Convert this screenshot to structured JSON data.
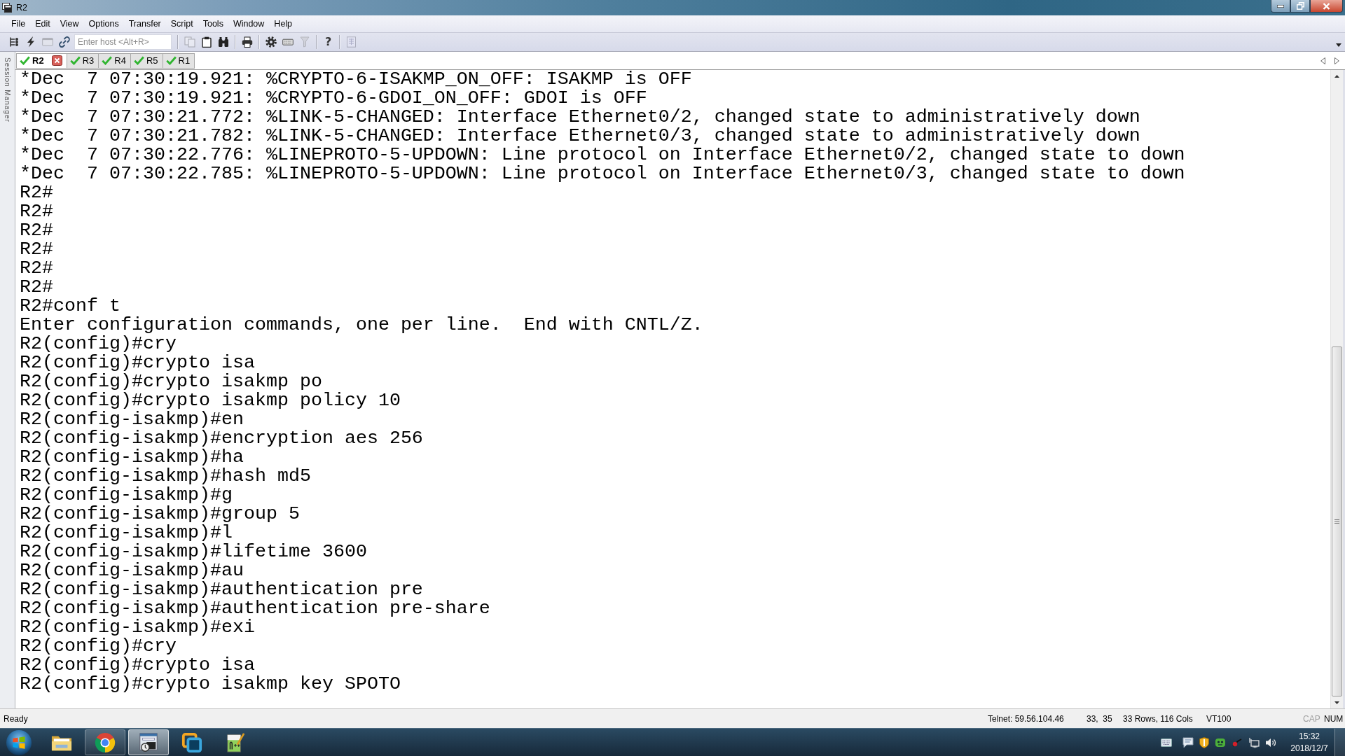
{
  "window": {
    "title": "R2"
  },
  "menu": [
    "File",
    "Edit",
    "View",
    "Options",
    "Transfer",
    "Script",
    "Tools",
    "Window",
    "Help"
  ],
  "toolbar": {
    "groups": [
      [
        {
          "kind": "connect",
          "disabled": false
        },
        {
          "kind": "quick_connect",
          "disabled": false
        },
        {
          "kind": "connect_in_tab",
          "disabled": true
        },
        {
          "kind": "reconnect",
          "disabled": false
        },
        {
          "kind": "host_field",
          "placeholder": "Enter host <Alt+R>",
          "disabled": false
        }
      ],
      [
        {
          "kind": "copy",
          "disabled": true
        },
        {
          "kind": "paste",
          "disabled": false
        },
        {
          "kind": "find",
          "disabled": false
        }
      ],
      [
        {
          "kind": "print",
          "disabled": false
        }
      ],
      [
        {
          "kind": "settings",
          "disabled": false
        },
        {
          "kind": "keymap",
          "disabled": false
        },
        {
          "kind": "filter",
          "disabled": true
        }
      ],
      [
        {
          "kind": "help",
          "label": "?",
          "disabled": false
        }
      ],
      [
        {
          "kind": "document",
          "disabled": true
        }
      ]
    ]
  },
  "side_panel": {
    "label": "Session Manager"
  },
  "tabs": [
    {
      "label": "R2",
      "selected": true,
      "connected": true
    },
    {
      "label": "R3",
      "selected": false,
      "connected": true
    },
    {
      "label": "R4",
      "selected": false,
      "connected": true
    },
    {
      "label": "R5",
      "selected": false,
      "connected": true
    },
    {
      "label": "R1",
      "selected": false,
      "connected": true
    }
  ],
  "terminal": {
    "lines": [
      "*Dec  7 07:30:19.921: %CRYPTO-6-ISAKMP_ON_OFF: ISAKMP is OFF",
      "*Dec  7 07:30:19.921: %CRYPTO-6-GDOI_ON_OFF: GDOI is OFF",
      "*Dec  7 07:30:21.772: %LINK-5-CHANGED: Interface Ethernet0/2, changed state to administratively down",
      "*Dec  7 07:30:21.782: %LINK-5-CHANGED: Interface Ethernet0/3, changed state to administratively down",
      "*Dec  7 07:30:22.776: %LINEPROTO-5-UPDOWN: Line protocol on Interface Ethernet0/2, changed state to down",
      "*Dec  7 07:30:22.785: %LINEPROTO-5-UPDOWN: Line protocol on Interface Ethernet0/3, changed state to down",
      "R2#",
      "R2#",
      "R2#",
      "R2#",
      "R2#",
      "R2#",
      "R2#conf t",
      "Enter configuration commands, one per line.  End with CNTL/Z.",
      "R2(config)#cry",
      "R2(config)#crypto isa",
      "R2(config)#crypto isakmp po",
      "R2(config)#crypto isakmp policy 10",
      "R2(config-isakmp)#en",
      "R2(config-isakmp)#encryption aes 256",
      "R2(config-isakmp)#ha",
      "R2(config-isakmp)#hash md5",
      "R2(config-isakmp)#g",
      "R2(config-isakmp)#group 5",
      "R2(config-isakmp)#l",
      "R2(config-isakmp)#lifetime 3600",
      "R2(config-isakmp)#au",
      "R2(config-isakmp)#authentication pre",
      "R2(config-isakmp)#authentication pre-share",
      "R2(config-isakmp)#exi",
      "R2(config)#cry",
      "R2(config)#crypto isa",
      "R2(config)#crypto isakmp key SPOTO"
    ]
  },
  "status_bar": {
    "message": "Ready",
    "connection": "Telnet: 59.56.104.46",
    "cursor": "33,  35",
    "size": "33 Rows, 116 Cols",
    "emulation": "VT100",
    "indicators": [
      {
        "label": "CAP",
        "on": false
      },
      {
        "label": "NUM",
        "on": true
      }
    ]
  },
  "taskbar": {
    "apps": [
      {
        "kind": "folder",
        "running": false,
        "selected": false
      },
      {
        "kind": "browser",
        "running": true,
        "selected": false
      },
      {
        "kind": "terminal",
        "running": true,
        "selected": true
      },
      {
        "kind": "virtual_machine",
        "running": false,
        "selected": false
      },
      {
        "kind": "editor",
        "running": false,
        "selected": false
      }
    ],
    "clock": {
      "time": "15:32",
      "date": "2018/12/7"
    }
  }
}
